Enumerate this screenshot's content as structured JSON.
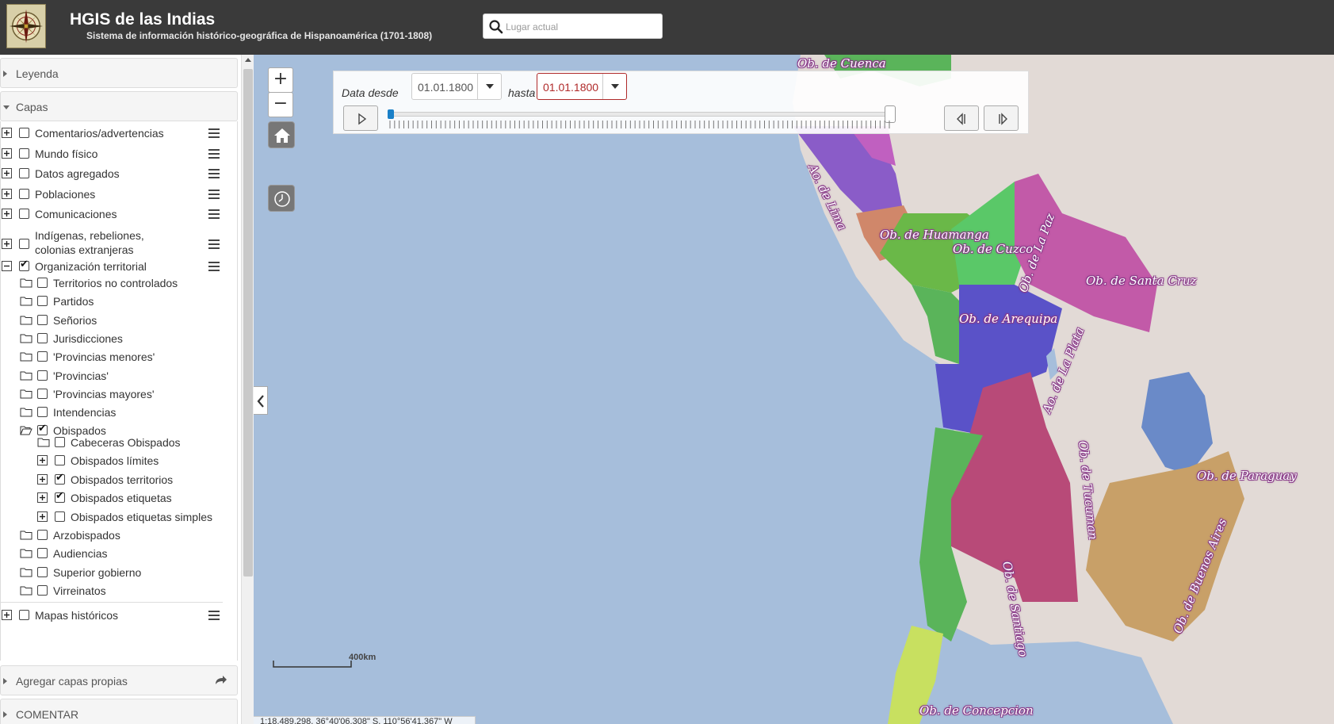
{
  "header": {
    "title": "HGIS de las Indias",
    "subtitle": "Sistema de información histórico-geográfica de Hispanoamérica (1701-1808)",
    "search_placeholder": "Lugar actual",
    "logo_icon": "compass-rose-icon"
  },
  "sidebar": {
    "legend_label": "Leyenda",
    "layers_label": "Capas",
    "add_layers_label": "Agregar capas propias",
    "comment_label": "COMENTAR",
    "top_layers": [
      {
        "label": "Comentarios/advertencias",
        "checked": false
      },
      {
        "label": "Mundo físico",
        "checked": false
      },
      {
        "label": "Datos agregados",
        "checked": false
      },
      {
        "label": "Poblaciones",
        "checked": false
      },
      {
        "label": "Comunicaciones",
        "checked": false
      },
      {
        "label": "Indígenas, rebeliones,",
        "label2": "colonias extranjeras",
        "checked": false
      },
      {
        "label": "Organización territorial",
        "checked": true
      }
    ],
    "org_children": [
      {
        "label": "Territorios no controlados",
        "checked": false
      },
      {
        "label": "Partidos",
        "checked": false
      },
      {
        "label": "Señorios",
        "checked": false
      },
      {
        "label": "Jurisdicciones",
        "checked": false
      },
      {
        "label": "'Provincias menores'",
        "checked": false
      },
      {
        "label": "'Provincias'",
        "checked": false
      },
      {
        "label": "'Provincias mayores'",
        "checked": false
      },
      {
        "label": "Intendencias",
        "checked": false
      },
      {
        "label": "Obispados",
        "checked": true
      }
    ],
    "obispado_children": [
      {
        "label": "Cabeceras Obispados",
        "checked": false
      },
      {
        "label": "Obispados límites",
        "checked": false
      },
      {
        "label": "Obispados territorios",
        "checked": true
      },
      {
        "label": "Obispados etiquetas",
        "checked": true
      },
      {
        "label": "Obispados etiquetas simples",
        "checked": false
      }
    ],
    "org_tail": [
      {
        "label": "Arzobispados",
        "checked": false
      },
      {
        "label": "Audiencias",
        "checked": false
      },
      {
        "label": "Superior gobierno",
        "checked": false
      },
      {
        "label": "Virreinatos",
        "checked": false
      }
    ],
    "bottom_layer": {
      "label": "Mapas históricos",
      "checked": false
    }
  },
  "map": {
    "zoom_in": "+",
    "zoom_out": "−",
    "time": {
      "from_label": "Data desde",
      "from_value": "01.01.1800",
      "to_label": "hasta",
      "to_value": "01.01.1800"
    },
    "scale_label": "400km",
    "coordinates": "1:18,489,298, 36°40'06.308\" S, 110°56'41.367\" W",
    "labels": [
      "Ob. de Cuenca",
      "Ao. de Lima",
      "Ob. de Huamanga",
      "Ob. de Cuzco",
      "Ob. de La Paz",
      "Ob. de Santa Cruz",
      "Ob. de Arequipa",
      "Ao. de La Plata",
      "Ob. de Tucuman",
      "Ob. de Paraguay",
      "Ob. de Santiago",
      "Ob. de Buenos Aires",
      "Ob. de Concepcion"
    ],
    "colors": {
      "ocean": "#a6bedb",
      "land": "#e4dcd8",
      "lima": "#8a5cc8",
      "huamanga": "#d0876a",
      "cuzco": "#6ab848",
      "santacruz": "#c25aa8",
      "laplata": "#5a52c8",
      "tucuman": "#b84a78",
      "paraguay": "#6a8ac8",
      "santiago": "#5ab45a",
      "buenosaires": "#c8a068",
      "concepcion": "#c8e060"
    }
  }
}
